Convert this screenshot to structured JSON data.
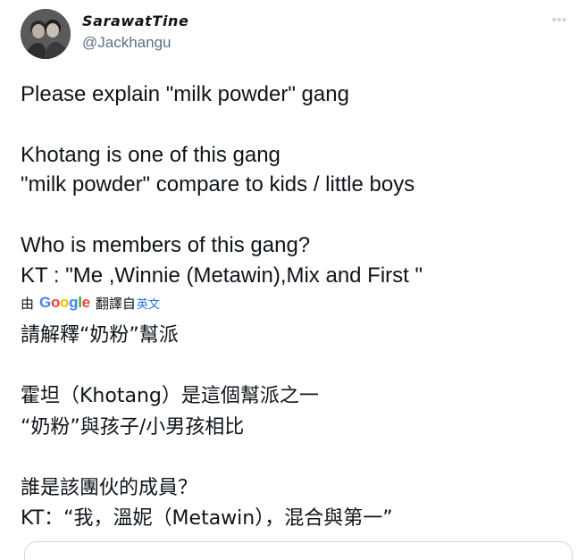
{
  "tweet": {
    "display_name": "SarawatTine",
    "handle": "@Jackhangu",
    "more_icon": "more-horizontal-icon",
    "more_glyph": "◦◦◦",
    "text": "Please explain \"milk powder\" gang\n\nKhotang is one of this gang\n\"milk powder\" compare to  kids / little boys\n\nWho is members of this gang?\nKT :  \"Me ,Winnie (Metawin),Mix and First \"",
    "translation": {
      "prefix": "由",
      "google_logo_text": "Google",
      "middle": "翻譯自",
      "source_language": "英文"
    },
    "translated_text": "請解釋“奶粉”幫派\n\n霍坦（Khotang）是這個幫派之一\n“奶粉”與孩子/小男孩相比\n\n誰是該團伙的成員？\n KT：“我，溫妮（Metawin），混合與第一”"
  }
}
